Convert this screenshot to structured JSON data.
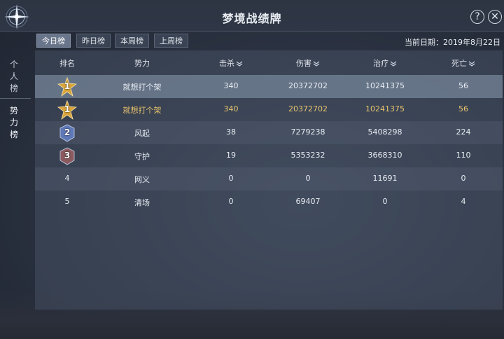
{
  "window": {
    "title": "梦境战绩牌",
    "help_label": "?",
    "close_label": "✕"
  },
  "side_tabs": [
    {
      "chars": [
        "个",
        "人",
        "榜"
      ],
      "active": false
    },
    {
      "chars": [
        "势",
        "力",
        "榜"
      ],
      "active": true
    }
  ],
  "period_tabs": [
    {
      "label": "今日榜",
      "active": true
    },
    {
      "label": "昨日榜",
      "active": false
    },
    {
      "label": "本周榜",
      "active": false
    },
    {
      "label": "上周榜",
      "active": false
    }
  ],
  "current_date": "当前日期：2019年8月22日",
  "table": {
    "headers": [
      "排名",
      "势力",
      "击杀",
      "伤害",
      "治疗",
      "死亡"
    ],
    "rows": [
      {
        "rank": "1",
        "badge": "gold",
        "name": "就想打个架",
        "kills": "340",
        "damage": "20372702",
        "heal": "10241375",
        "deaths": "56",
        "style": "highlight"
      },
      {
        "rank": "1",
        "badge": "gold",
        "name": "就想打个架",
        "kills": "340",
        "damage": "20372702",
        "heal": "10241375",
        "deaths": "56",
        "style": "gold"
      },
      {
        "rank": "2",
        "badge": "silver",
        "name": "风起",
        "kills": "38",
        "damage": "7279238",
        "heal": "5408298",
        "deaths": "224",
        "style": "odd"
      },
      {
        "rank": "3",
        "badge": "bronze",
        "name": "守护",
        "kills": "19",
        "damage": "5353232",
        "heal": "3668310",
        "deaths": "110",
        "style": "normal"
      },
      {
        "rank": "4",
        "badge": "none",
        "name": "网义",
        "kills": "0",
        "damage": "0",
        "heal": "11691",
        "deaths": "0",
        "style": "odd"
      },
      {
        "rank": "5",
        "badge": "none",
        "name": "清场",
        "kills": "0",
        "damage": "69407",
        "heal": "0",
        "deaths": "4",
        "style": "normal"
      }
    ]
  },
  "colors": {
    "gold_text": "#e8c36d",
    "badge_gold": "#d9a53a",
    "badge_silver": "#5f78b8",
    "badge_bronze": "#8a5a5e"
  },
  "icons": {
    "sort": "chevron-double-down-icon",
    "emblem": "star-compass-icon"
  }
}
